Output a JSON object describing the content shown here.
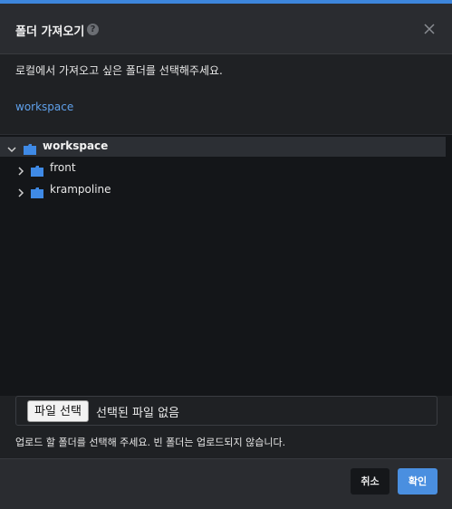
{
  "dialog": {
    "title": "폴더 가져오기",
    "help_icon": "question-circle-icon",
    "close_icon": "close-icon",
    "instruction": "로컬에서 가져오고 싶은 폴더를 선택해주세요.",
    "workspace_link": "workspace"
  },
  "tree": {
    "root": {
      "label": "workspace",
      "expanded": true,
      "selected": true,
      "icon": "folder-icon"
    },
    "children": [
      {
        "label": "front",
        "expanded": false,
        "icon": "folder-icon"
      },
      {
        "label": "krampoline",
        "expanded": false,
        "icon": "folder-icon"
      }
    ]
  },
  "file_input": {
    "button_label": "파일 선택",
    "status": "선택된 파일 없음"
  },
  "notice": "업로드 할 폴더를 선택해 주세요. 빈 폴더는 업로드되지 않습니다.",
  "footer": {
    "cancel_label": "취소",
    "confirm_label": "확인"
  },
  "colors": {
    "accent": "#3d86dc",
    "folder": "#3f8ae6",
    "link": "#5fa0ea",
    "confirm": "#4a8fe0"
  }
}
